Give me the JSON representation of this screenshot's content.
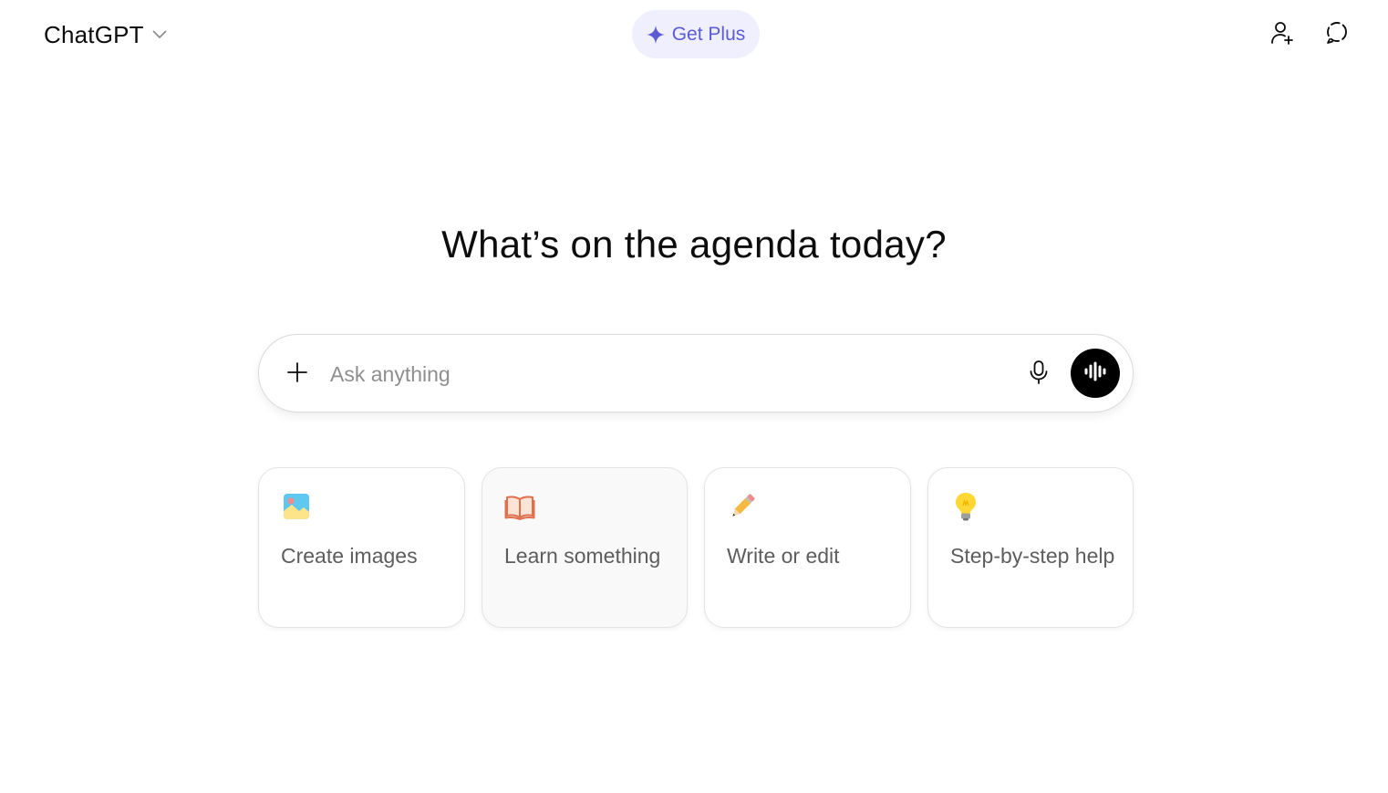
{
  "header": {
    "model_name": "ChatGPT",
    "upgrade_label": "Get Plus",
    "icons": [
      "chevron-down-icon",
      "sparkle-icon",
      "add-user-icon",
      "temporary-chat-icon"
    ]
  },
  "main": {
    "headline": "What’s on the agenda today?"
  },
  "composer": {
    "placeholder": "Ask anything",
    "value": "",
    "icons": [
      "plus-icon",
      "microphone-icon",
      "voice-waveform-icon"
    ]
  },
  "suggestions": [
    {
      "label": "Create images",
      "icon": "image-icon"
    },
    {
      "label": "Learn something",
      "icon": "book-icon"
    },
    {
      "label": "Write or edit",
      "icon": "pencil-icon"
    },
    {
      "label": "Step-by-step help",
      "icon": "lightbulb-icon"
    }
  ],
  "colors": {
    "accent": "#5b5bd6",
    "accent_bg": "#f0effd",
    "voice_button": "#000000",
    "muted_text": "#5d5d5d",
    "placeholder_text": "#8e8e8e"
  }
}
